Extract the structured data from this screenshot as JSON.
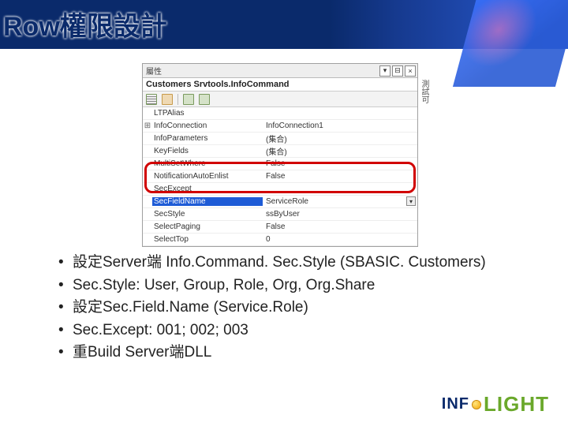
{
  "title": "Row權限設計",
  "panel": {
    "titlebar_label": "屬性",
    "header": "Customers  Srvtools.InfoCommand",
    "rows": [
      {
        "expand": "",
        "name": "LTPAlias",
        "value": ""
      },
      {
        "expand": "⊞",
        "name": "InfoConnection",
        "value": "InfoConnection1"
      },
      {
        "expand": "",
        "name": "InfoParameters",
        "value": "(集合)"
      },
      {
        "expand": "",
        "name": "KeyFields",
        "value": "(集合)"
      },
      {
        "expand": "",
        "name": "MultiSetWhere",
        "value": "False"
      },
      {
        "expand": "",
        "name": "NotificationAutoEnlist",
        "value": "False"
      },
      {
        "expand": "",
        "name": "SecExcept",
        "value": ""
      },
      {
        "expand": "",
        "name": "SecFieldName",
        "value": "ServiceRole",
        "selected": true
      },
      {
        "expand": "",
        "name": "SecStyle",
        "value": "ssByUser"
      },
      {
        "expand": "",
        "name": "SelectPaging",
        "value": "False"
      },
      {
        "expand": "",
        "name": "SelectTop",
        "value": "0"
      }
    ],
    "side_tab": "測試可"
  },
  "bullets": [
    "設定Server端 Info.Command. Sec.Style (SBASIC. Customers)",
    "Sec.Style: User, Group, Role, Org, Org.Share",
    "設定Sec.Field.Name (Service.Role)",
    "Sec.Except: 001; 002; 003",
    "重Build Server端DLL"
  ],
  "logo": {
    "part1": "INF",
    "part2": "LIGHT"
  }
}
